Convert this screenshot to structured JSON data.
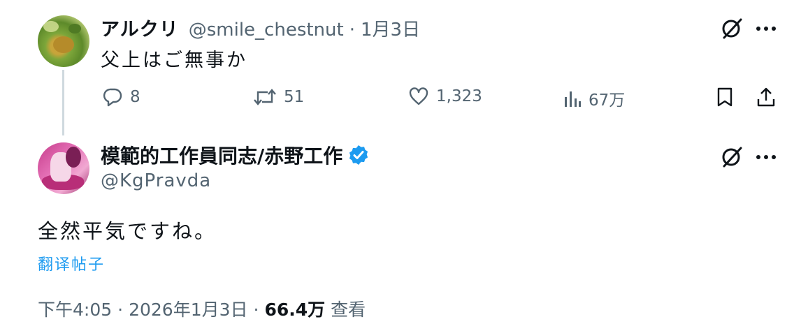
{
  "reply": {
    "display_name": "アルクリ",
    "handle": "@smile_chestnut",
    "separator": "·",
    "date": "1月3日",
    "text": "父上はご無事か",
    "actions": {
      "replies": "8",
      "reposts": "51",
      "likes": "1,323",
      "views": "67万"
    },
    "avatar_icon": "avatar-bird-image"
  },
  "tweet": {
    "display_name": "模範的工作員同志/赤野工作",
    "verified": true,
    "verified_color": "#1d9bf0",
    "handle": "@KgPravda",
    "text": "全然平気ですね。",
    "translate_label": "翻译帖子",
    "meta": {
      "time": "下午4:05",
      "separator1": "·",
      "date": "2026年1月3日",
      "separator2": "·",
      "views_count": "66.4万",
      "views_label": "查看"
    },
    "avatar_icon": "avatar-anime-image"
  },
  "icons": {
    "grok": "grok-icon",
    "more": "more-icon",
    "reply": "reply-icon",
    "repost": "repost-icon",
    "like": "heart-icon",
    "views": "analytics-icon",
    "bookmark": "bookmark-icon",
    "share": "share-icon"
  },
  "colors": {
    "text": "#0f1419",
    "secondary": "#536471",
    "link": "#1d9bf0",
    "thread_line": "#cfd9de"
  }
}
